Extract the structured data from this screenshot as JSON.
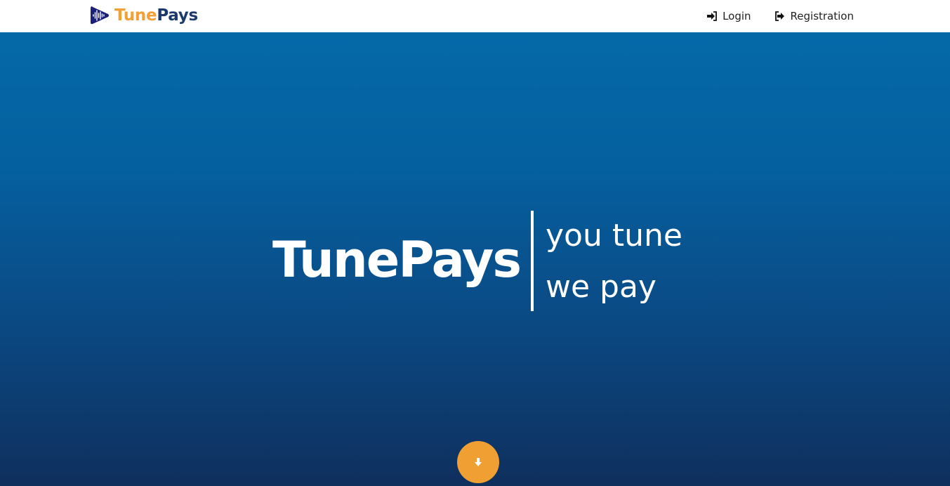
{
  "navbar": {
    "brand": {
      "logo_icon": "play-soundwave-icon",
      "name_part1": "Tune",
      "name_part2": "Pays",
      "colors": {
        "part1": "#f2a036",
        "part2": "#1b3a6b"
      }
    },
    "links": [
      {
        "label": "Login",
        "icon": "sign-in-icon"
      },
      {
        "label": "Registration",
        "icon": "sign-out-icon"
      }
    ]
  },
  "hero": {
    "title": "TunePays",
    "tagline_line1": "you tune",
    "tagline_line2": "we pay",
    "background_top": "#0569a8",
    "background_bottom": "#0f2f5d",
    "scroll_button_icon": "arrow-down-icon",
    "scroll_button_color": "#f0a033"
  }
}
